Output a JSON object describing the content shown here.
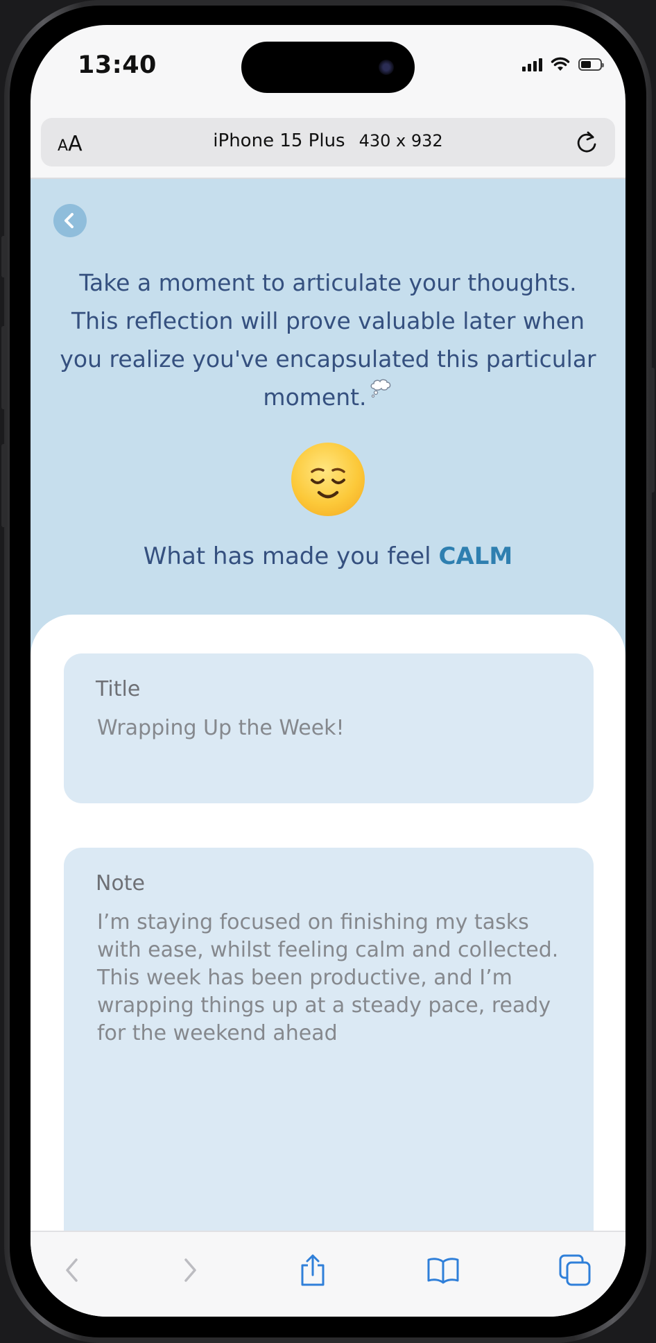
{
  "status_bar": {
    "time": "13:40"
  },
  "browser": {
    "text_size_small": "A",
    "text_size_big": "A",
    "device_name": "iPhone 15 Plus",
    "device_dims": "430 x 932"
  },
  "app": {
    "intro_text": "Take a moment to articulate your thoughts. This reflection will prove valuable later when you realize you've encapsulated this particular moment.",
    "feel_prefix": "What has made you feel ",
    "mood": "CALM",
    "title_card": {
      "label": "Title",
      "value": "Wrapping Up the Week!"
    },
    "note_card": {
      "label": "Note",
      "value": "I’m staying focused on finishing my tasks with ease, whilst feeling calm and collected. This week has been productive, and I’m wrapping things up at a steady pace, ready for the weekend ahead"
    }
  },
  "colors": {
    "header_bg": "#c6deed",
    "text_primary": "#35507f",
    "mood_accent": "#2e7fb0",
    "card_bg": "#dbe9f4",
    "toolbar_icon": "#2f7fd9"
  },
  "toolbar": {
    "icons": [
      "back-icon",
      "forward-icon",
      "share-icon",
      "bookmarks-icon",
      "tabs-icon"
    ]
  }
}
